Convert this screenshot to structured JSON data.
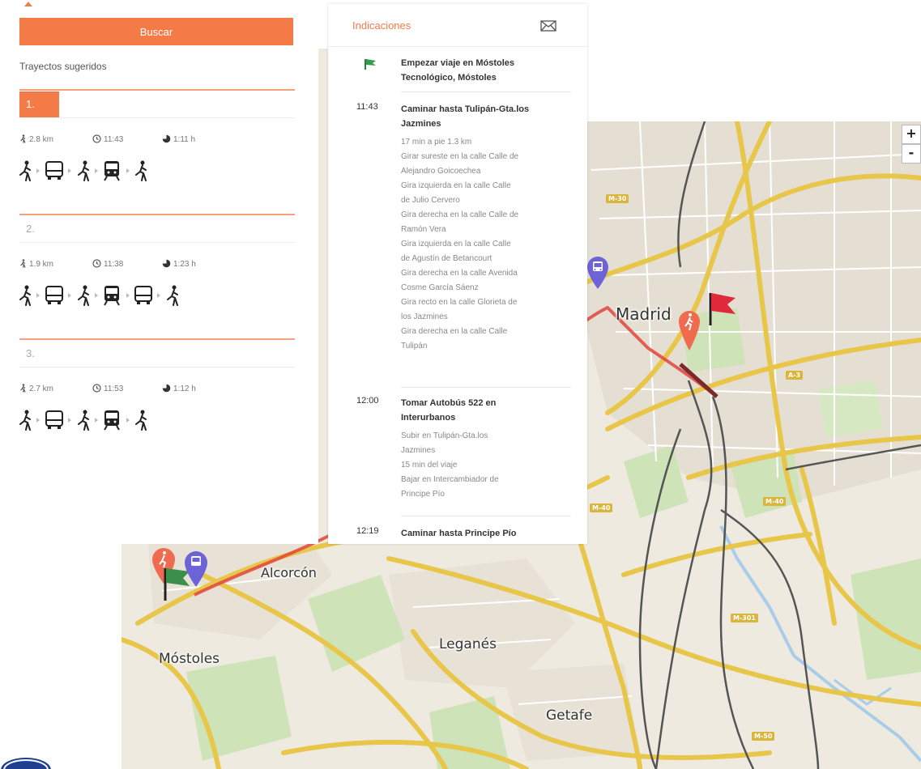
{
  "search_panel": {
    "search_button_label": "Buscar",
    "suggested_title": "Trayectos sugeridos",
    "routes": [
      {
        "number": "1.",
        "distance": "2.8 km",
        "departure": "11:43",
        "duration": "1:11 h",
        "legs": [
          "walk",
          "bus",
          "walk",
          "train",
          "walk"
        ]
      },
      {
        "number": "2.",
        "distance": "1.9 km",
        "departure": "11:38",
        "duration": "1:23 h",
        "legs": [
          "walk",
          "bus",
          "walk",
          "train",
          "bus",
          "walk"
        ]
      },
      {
        "number": "3.",
        "distance": "2.7 km",
        "departure": "11:53",
        "duration": "1:12 h",
        "legs": [
          "walk",
          "bus",
          "walk",
          "train",
          "walk"
        ]
      }
    ]
  },
  "directions": {
    "title": "Indicaciones",
    "steps": [
      {
        "time": "",
        "title_lines": [
          "Empezar viaje en Móstoles",
          "Tecnológico, Móstoles"
        ],
        "sub": []
      },
      {
        "time": "11:43",
        "title_lines": [
          "Caminar hasta Tulipán-Gta.los",
          "Jazmines"
        ],
        "sub": [
          "17 min a pie 1.3 km",
          "Girar sureste en la calle Calle de",
          "Alejandro Goicoechea",
          "Gira izquierda en la calle Calle",
          "de Julio Cervero",
          "Gira derecha en la calle Calle de",
          "Ramón Vera",
          "Gira izquierda en la calle Calle",
          "de Agustín de Betancourt",
          "Gira derecha en la calle Avenida",
          "Cosme García Sáenz",
          "Gira recto en la calle Glorieta de",
          "los Jazmines",
          "Gira derecha en la calle Calle",
          "Tulipán"
        ]
      },
      {
        "time": "12:00",
        "title_lines": [
          "Tomar Autobús 522 en",
          "Interurbanos"
        ],
        "sub": [
          "Subir en Tulipán-Gta.los",
          "Jazmines",
          "15 min del viaje",
          "Bajar en Intercambiador de",
          "Principe Pío"
        ]
      },
      {
        "time": "12:19",
        "title_lines": [
          "Caminar hasta Principe Pío"
        ],
        "sub": []
      }
    ]
  },
  "map": {
    "cities": {
      "madrid": "Madrid",
      "alcorcon": "Alcorcón",
      "mostoles": "Móstoles",
      "leganes": "Leganés",
      "getafe": "Getafe"
    },
    "zoom_in": "+",
    "zoom_out": "-",
    "road_shields": {
      "m30": "M-30",
      "a3": "A-3",
      "m40": "M-40",
      "m40b": "M-40",
      "m301": "M-301",
      "m50": "M-50"
    },
    "route_color": "#e0453c",
    "start_flag_color": "#3a8f4a",
    "end_flag_color": "#e02a3a",
    "walk_marker_color": "#ef6a4f",
    "bus_marker_color": "#6b63d6"
  },
  "colors": {
    "accent": "#f47b48"
  }
}
